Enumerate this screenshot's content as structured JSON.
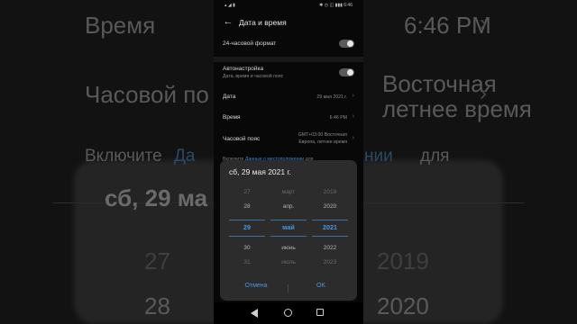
{
  "background": {
    "time_label": "Время",
    "time_value": "6:46 PM",
    "timezone_label": "Часовой по",
    "timezone_value_line1": "Восточная",
    "timezone_value_line2": "летнее время",
    "hint_prefix": "Включите",
    "hint_link_start": "Да",
    "hint_link_end": "нии",
    "hint_suffix": "для",
    "date_big": "сб, 29 ма",
    "num_27": "27",
    "num_28": "28",
    "num_2019": "2019",
    "num_2020": "2020"
  },
  "statusbar": {
    "left": "▴ ◢ ▮",
    "right": "✱ ◷ ◫ ▮▮▮ 6:46"
  },
  "header": {
    "back_icon": "arrow-left-icon",
    "title": "Дата и время"
  },
  "settings": {
    "format_24h": {
      "label": "24-часовой формат",
      "enabled": false
    },
    "auto": {
      "label": "Автонастройка",
      "sub": "Дата, время и часовой пояс",
      "enabled": false
    },
    "date": {
      "label": "Дата",
      "value": "29 мая 2021 г."
    },
    "time": {
      "label": "Время",
      "value": "6:46 PM"
    },
    "timezone": {
      "label": "Часовой пояс",
      "value_line1": "GMT+03:00 Восточная",
      "value_line2": "Европа, летнее время"
    }
  },
  "hint": {
    "prefix": "Включите",
    "link": "Данные о местоположении",
    "suffix": "для"
  },
  "dialog": {
    "title": "сб, 29 мая 2021 г.",
    "days": [
      "27",
      "28",
      "29",
      "30",
      "31"
    ],
    "months": [
      "март",
      "апр.",
      "май",
      "июнь",
      "июль"
    ],
    "years": [
      "2019",
      "2020",
      "2021",
      "2022",
      "2023"
    ],
    "selected_index": 2,
    "cancel_label": "Отмена",
    "ok_label": "OK"
  },
  "colors": {
    "accent": "#4a95e2",
    "dialog_bg": "#2c2c2c",
    "screen_bg": "#080808"
  }
}
